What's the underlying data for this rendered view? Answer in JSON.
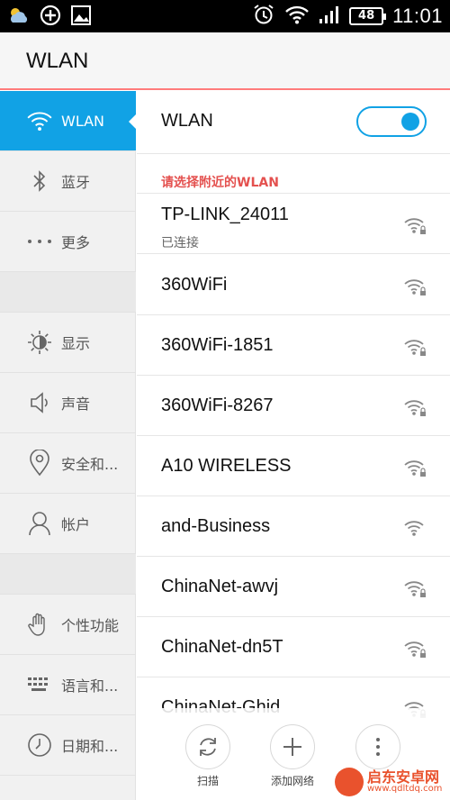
{
  "status_bar": {
    "time": "11:01",
    "battery": "48",
    "icons": [
      "weather-icon",
      "add-circle-icon",
      "image-icon",
      "alarm-icon",
      "wifi-icon",
      "signal-icon",
      "battery-icon"
    ]
  },
  "app_bar": {
    "title": "WLAN"
  },
  "sidebar": {
    "items": [
      {
        "label": "WLAN",
        "icon": "wifi-icon"
      },
      {
        "label": "蓝牙",
        "icon": "bluetooth-icon"
      },
      {
        "label": "更多",
        "icon": "more-dots-icon"
      },
      {
        "label": "显示",
        "icon": "brightness-icon"
      },
      {
        "label": "声音",
        "icon": "speaker-icon"
      },
      {
        "label": "安全和...",
        "icon": "location-pin-icon"
      },
      {
        "label": "帐户",
        "icon": "account-icon"
      },
      {
        "label": "个性功能",
        "icon": "hand-icon"
      },
      {
        "label": "语言和...",
        "icon": "keyboard-icon"
      },
      {
        "label": "日期和...",
        "icon": "clock-icon"
      }
    ]
  },
  "main": {
    "wlan_title": "WLAN",
    "wlan_enabled": true,
    "section_label": "请选择附近的WLAN",
    "networks": [
      {
        "name": "TP-LINK_24011",
        "status": "已连接",
        "secured": true
      },
      {
        "name": "360WiFi",
        "secured": true
      },
      {
        "name": "360WiFi-1851",
        "secured": true
      },
      {
        "name": "360WiFi-8267",
        "secured": true
      },
      {
        "name": "A10 WIRELESS",
        "secured": true
      },
      {
        "name": "and-Business",
        "secured": false
      },
      {
        "name": "ChinaNet-awvj",
        "secured": true
      },
      {
        "name": "ChinaNet-dn5T",
        "secured": true
      },
      {
        "name": "ChinaNet-Ghid",
        "secured": true
      }
    ]
  },
  "actions": {
    "scan": "扫描",
    "add_network": "添加网络"
  },
  "watermark": {
    "title": "启东安卓网",
    "url": "www.qdltdq.com"
  },
  "colors": {
    "accent": "#11a2e5",
    "section": "#e4514f",
    "appbar_line": "#ff7c7c"
  }
}
